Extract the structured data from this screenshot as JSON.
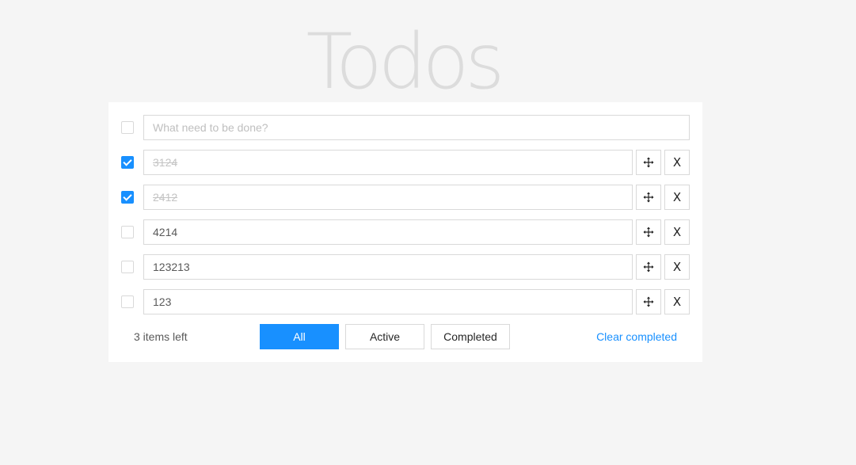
{
  "app": {
    "title": "Todos"
  },
  "new_todo": {
    "placeholder": "What need to be done?",
    "value": "",
    "checked": false
  },
  "todos": [
    {
      "text": "3124",
      "completed": true
    },
    {
      "text": "2412",
      "completed": true
    },
    {
      "text": "4214",
      "completed": false
    },
    {
      "text": "123213",
      "completed": false
    },
    {
      "text": "123",
      "completed": false
    }
  ],
  "footer": {
    "items_left": "3 items left",
    "filters": [
      {
        "label": "All",
        "active": true
      },
      {
        "label": "Active",
        "active": false
      },
      {
        "label": "Completed",
        "active": false
      }
    ],
    "clear_label": "Clear completed"
  },
  "icons": {
    "move": "move-icon",
    "delete_glyph": "X"
  },
  "colors": {
    "accent": "#1890ff",
    "title": "#dcdcdc",
    "background": "#f5f5f5"
  }
}
